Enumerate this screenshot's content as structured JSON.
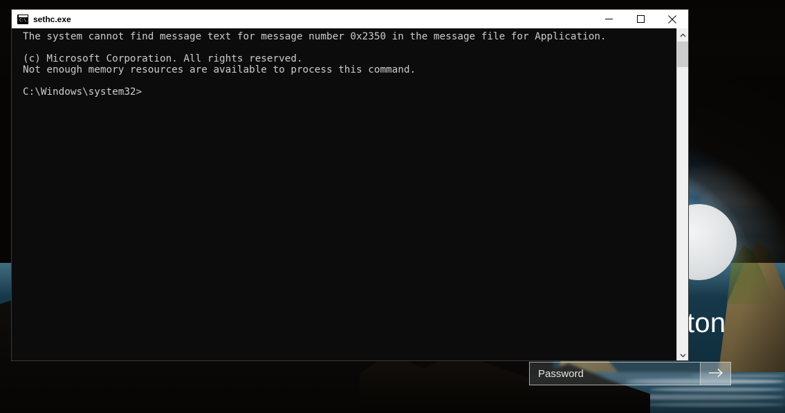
{
  "lock_screen": {
    "username": "oton",
    "avatar_icon": "user-avatar-circle",
    "password": {
      "value": "",
      "placeholder": "Password",
      "submit_icon": "arrow-right-icon"
    }
  },
  "console_window": {
    "title": "sethc.exe",
    "app_icon": "command-prompt-icon",
    "window_controls": {
      "minimize_icon": "minimize-icon",
      "maximize_icon": "maximize-icon",
      "close_icon": "close-icon"
    },
    "scrollbar": {
      "up_icon": "chevron-up-icon",
      "down_icon": "chevron-down-icon"
    },
    "output": "The system cannot find message text for message number 0x2350 in the message file for Application.\n\n(c) Microsoft Corporation. All rights reserved.\nNot enough memory resources are available to process this command.\n\nC:\\Windows\\system32>",
    "colors": {
      "background": "#0c0c0c",
      "text": "#cccccc",
      "titlebar": "#ffffff"
    }
  }
}
